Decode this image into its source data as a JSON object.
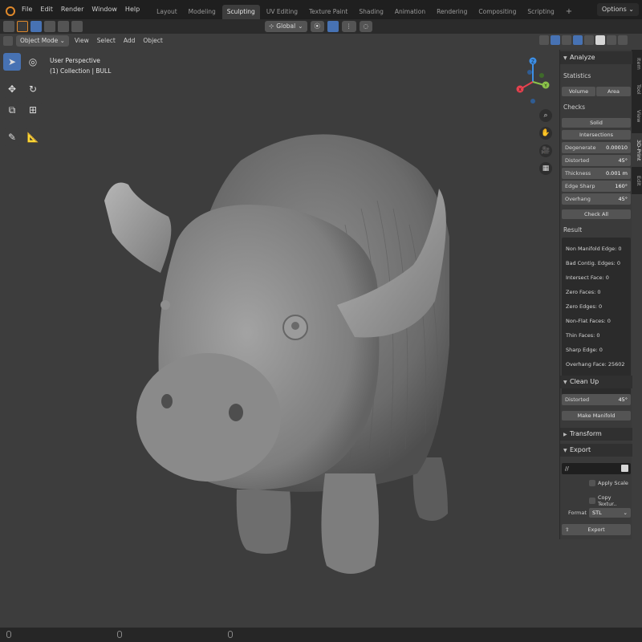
{
  "menu": [
    "File",
    "Edit",
    "Render",
    "Window",
    "Help"
  ],
  "workspaces": [
    "Layout",
    "Modeling",
    "Sculpting",
    "UV Editing",
    "Texture Paint",
    "Shading",
    "Animation",
    "Rendering",
    "Compositing",
    "Scripting"
  ],
  "active_workspace": "Sculpting",
  "add_workspace": "+",
  "options_label": "Options",
  "transform": {
    "orientation": "Global"
  },
  "viewport_header": {
    "mode": "Object Mode",
    "menus": [
      "View",
      "Select",
      "Add",
      "Object"
    ]
  },
  "viewport_info": {
    "perspective": "User Perspective",
    "collection": "(1) Collection | BULL"
  },
  "gizmo": {
    "x": "X",
    "y": "Y",
    "z": "Z"
  },
  "sidebar_tabs": [
    "Item",
    "Tool",
    "View",
    "3D-Print",
    "Edit"
  ],
  "active_sidebar_tab": "3D-Print",
  "analyze": {
    "title": "Analyze",
    "statistics_label": "Statistics",
    "volume_btn": "Volume",
    "area_btn": "Area",
    "checks_label": "Checks",
    "solid_btn": "Solid",
    "intersections_btn": "Intersections",
    "degenerate": {
      "label": "Degenerate",
      "value": "0.00010"
    },
    "distorted": {
      "label": "Distorted",
      "value": "45°"
    },
    "thickness": {
      "label": "Thickness",
      "value": "0.001 m"
    },
    "edge_sharp": {
      "label": "Edge Sharp",
      "value": "160°"
    },
    "overhang": {
      "label": "Overhang",
      "value": "45°"
    },
    "check_all_btn": "Check All",
    "result_label": "Result",
    "results": [
      "Non Manifold Edge: 0",
      "Bad Contig. Edges: 0",
      "Intersect Face: 0",
      "Zero Faces: 0",
      "Zero Edges: 0",
      "Non-Flat Faces: 0",
      "Thin Faces: 0",
      "Sharp Edge: 0",
      "Overhang Face: 25602"
    ]
  },
  "clean_up": {
    "title": "Clean Up",
    "distorted": {
      "label": "Distorted",
      "value": "45°"
    },
    "make_manifold_btn": "Make Manifold"
  },
  "transform_panel": {
    "title": "Transform"
  },
  "export": {
    "title": "Export",
    "path": "//",
    "apply_scale": "Apply Scale",
    "copy_textures": "Copy Textur..",
    "format_label": "Format",
    "format_value": "STL",
    "export_btn": "Export"
  },
  "colors": {
    "accent": "#4772b3",
    "x_axis": "#e8424f",
    "y_axis": "#8bc34a",
    "z_axis": "#3d8fe6",
    "logo": "#e0892b"
  }
}
